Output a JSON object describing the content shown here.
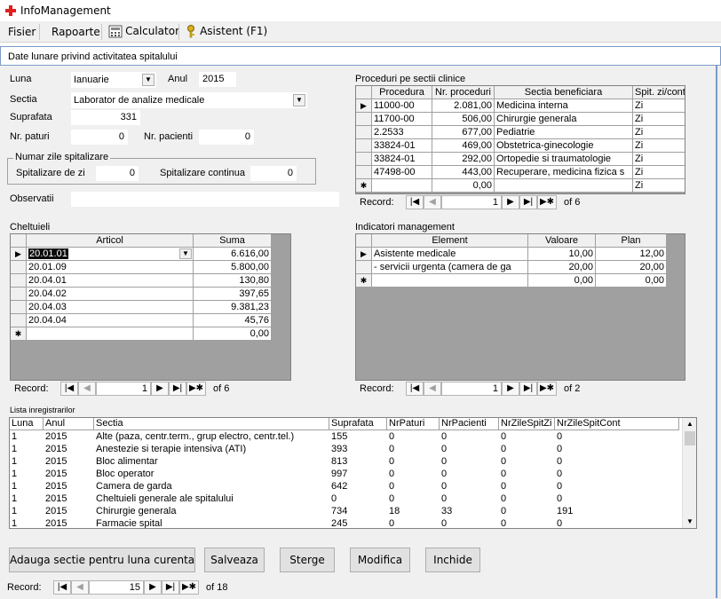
{
  "window": {
    "title": "InfoManagement"
  },
  "menu": {
    "fisier": "Fisier",
    "rapoarte": "Rapoarte",
    "calculator": "Calculator",
    "asistent": "Asistent (F1)"
  },
  "form": {
    "title": "Date lunare privind activitatea spitalului",
    "luna_label": "Luna",
    "luna_value": "Ianuarie",
    "anul_label": "Anul",
    "anul_value": "2015",
    "sectia_label": "Sectia",
    "sectia_value": "Laborator de analize medicale",
    "suprafata_label": "Suprafata",
    "suprafata_value": "331",
    "paturi_label": "Nr. paturi",
    "paturi_value": "0",
    "pacienti_label": "Nr. pacienti",
    "pacienti_value": "0",
    "group_title": "Numar zile spitalizare",
    "spitzi_label": "Spitalizare de zi",
    "spitzi_value": "0",
    "spitcont_label": "Spitalizare continua",
    "spitcont_value": "0",
    "observatii_label": "Observatii",
    "observatii_value": ""
  },
  "cheltuieli": {
    "title": "Cheltuieli",
    "headers": [
      "Articol",
      "Suma"
    ],
    "rows": [
      [
        "20.01.01",
        "6.616,00"
      ],
      [
        "20.01.09",
        "5.800,00"
      ],
      [
        "20.04.01",
        "130,80"
      ],
      [
        "20.04.02",
        "397,65"
      ],
      [
        "20.04.03",
        "9.381,23"
      ],
      [
        "20.04.04",
        "45,76"
      ]
    ],
    "new_row": [
      "",
      "0,00"
    ],
    "nav": {
      "label": "Record:",
      "current": "1",
      "of": "of 6"
    }
  },
  "proceduri": {
    "title": "Proceduri pe sectii clinice",
    "headers": [
      "Procedura",
      "Nr. proceduri",
      "Sectia beneficiara",
      "Spit. zi/cont"
    ],
    "rows": [
      [
        "11000-00",
        "2.081,00",
        "Medicina interna",
        "Zi"
      ],
      [
        "11700-00",
        "506,00",
        "Chirurgie generala",
        "Zi"
      ],
      [
        "2.2533",
        "677,00",
        "Pediatrie",
        "Zi"
      ],
      [
        "33824-01",
        "469,00",
        "Obstetrica-ginecologie",
        "Zi"
      ],
      [
        "33824-01",
        "292,00",
        "Ortopedie si traumatologie",
        "Zi"
      ],
      [
        "47498-00",
        "443,00",
        "Recuperare, medicina fizica s",
        "Zi"
      ]
    ],
    "new_row": [
      "",
      "0,00",
      "",
      "Zi"
    ],
    "nav": {
      "label": "Record:",
      "current": "1",
      "of": "of 6"
    }
  },
  "indicatori": {
    "title": "Indicatori management",
    "headers": [
      "Element",
      "Valoare",
      "Plan"
    ],
    "rows": [
      [
        "Asistente medicale",
        "10,00",
        "12,00"
      ],
      [
        " - servicii urgenta (camera de ga",
        "20,00",
        "20,00"
      ]
    ],
    "new_row": [
      "",
      "0,00",
      "0,00"
    ],
    "nav": {
      "label": "Record:",
      "current": "1",
      "of": "of 2"
    }
  },
  "lista": {
    "title": "Lista inregistrarilor",
    "headers": [
      "Luna",
      "Anul",
      "Sectia",
      "Suprafata",
      "NrPaturi",
      "NrPacienti",
      "NrZileSpitZi",
      "NrZileSpitCont"
    ],
    "rows": [
      [
        "1",
        "2015",
        "Alte (paza, centr.term., grup electro, centr.tel.)",
        "155",
        "0",
        "0",
        "0",
        "0"
      ],
      [
        "1",
        "2015",
        "Anestezie si terapie intensiva (ATI)",
        "393",
        "0",
        "0",
        "0",
        "0"
      ],
      [
        "1",
        "2015",
        "Bloc alimentar",
        "813",
        "0",
        "0",
        "0",
        "0"
      ],
      [
        "1",
        "2015",
        "Bloc operator",
        "997",
        "0",
        "0",
        "0",
        "0"
      ],
      [
        "1",
        "2015",
        "Camera de garda",
        "642",
        "0",
        "0",
        "0",
        "0"
      ],
      [
        "1",
        "2015",
        "Cheltuieli generale ale spitalului",
        "0",
        "0",
        "0",
        "0",
        "0"
      ],
      [
        "1",
        "2015",
        "Chirurgie generala",
        "734",
        "18",
        "33",
        "0",
        "191"
      ],
      [
        "1",
        "2015",
        "Farmacie spital",
        "245",
        "0",
        "0",
        "0",
        "0"
      ]
    ]
  },
  "buttons": {
    "adauga": "Adauga sectie pentru luna curenta",
    "salveaza": "Salveaza",
    "sterge": "Sterge",
    "modifica": "Modifica",
    "inchide": "Inchide"
  },
  "main_nav": {
    "label": "Record:",
    "current": "15",
    "of": "of 18"
  },
  "colors": {
    "accent": "#7a9cc9",
    "app_icon": "#e02020"
  }
}
